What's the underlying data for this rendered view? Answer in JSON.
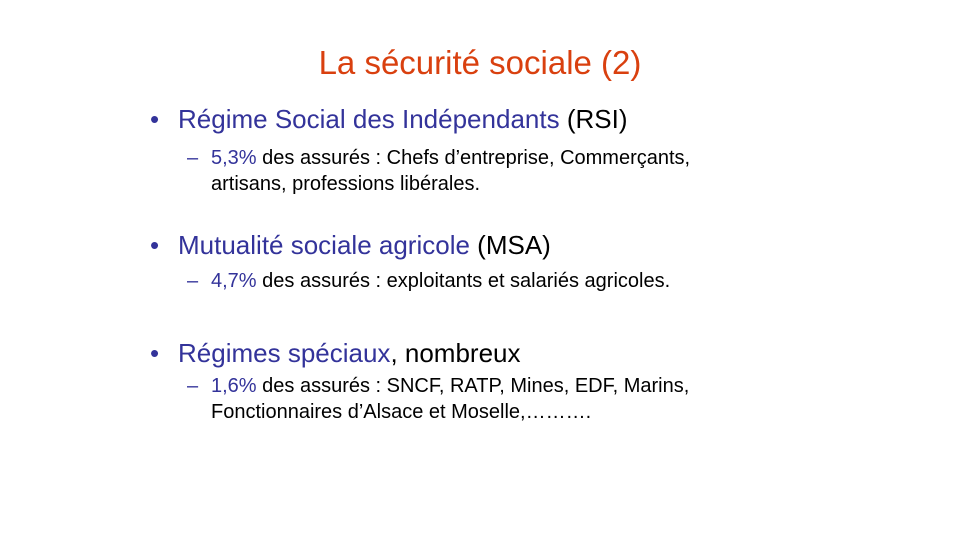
{
  "colors": {
    "title": "#D9400F",
    "highlight": "#33339A",
    "text": "#000000",
    "background": "#FFFFFF"
  },
  "slide": {
    "title": "La sécurité sociale (2)",
    "bullet_marker": "•",
    "dash_marker": "–",
    "items": [
      {
        "highlight": "Régime Social des Indépendants",
        "rest": " (RSI)",
        "sub_highlight": "5,3%",
        "sub_line1": " des assurés : Chefs d’entreprise, Commerçants,",
        "sub_line2": "artisans, professions libérales."
      },
      {
        "highlight": "Mutualité sociale agricole",
        "rest": " (MSA)",
        "sub_highlight": "4,7%",
        "sub_line1": " des assurés : exploitants et salariés agricoles."
      },
      {
        "highlight": "Régimes spéciaux",
        "rest": ", nombreux",
        "sub_highlight": "1,6%",
        "sub_line1": " des assurés : SNCF, RATP,  Mines, EDF, Marins,",
        "sub_line2": "Fonctionnaires d’Alsace et Moselle,………."
      }
    ]
  }
}
